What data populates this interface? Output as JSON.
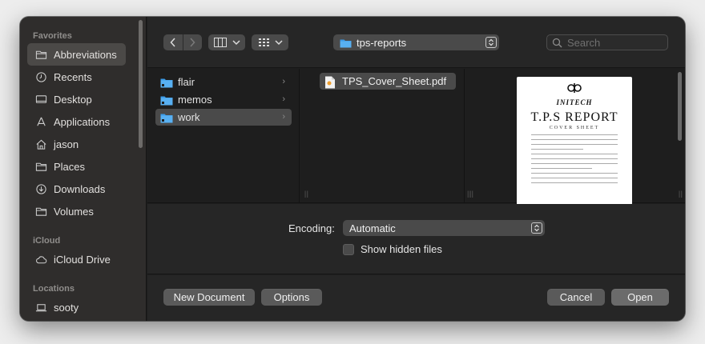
{
  "sidebar": {
    "favorites_title": "Favorites",
    "favorites": [
      {
        "label": "Abbreviations",
        "icon": "folder-icon"
      },
      {
        "label": "Recents",
        "icon": "clock-icon"
      },
      {
        "label": "Desktop",
        "icon": "desktop-icon"
      },
      {
        "label": "Applications",
        "icon": "applications-icon"
      },
      {
        "label": "jason",
        "icon": "home-icon"
      },
      {
        "label": "Places",
        "icon": "folder-icon"
      },
      {
        "label": "Downloads",
        "icon": "download-icon"
      },
      {
        "label": "Volumes",
        "icon": "folder-icon"
      }
    ],
    "icloud_title": "iCloud",
    "icloud": [
      {
        "label": "iCloud Drive",
        "icon": "cloud-icon"
      }
    ],
    "locations_title": "Locations",
    "locations": [
      {
        "label": "sooty",
        "icon": "laptop-icon"
      }
    ]
  },
  "toolbar": {
    "path_label": "tps-reports",
    "search_placeholder": "Search"
  },
  "browser": {
    "column1": [
      {
        "label": "flair"
      },
      {
        "label": "memos"
      },
      {
        "label": "work"
      }
    ],
    "column2": [
      {
        "label": "TPS_Cover_Sheet.pdf"
      }
    ],
    "preview": {
      "company": "INITECH",
      "title": "T.P.S  REPORT",
      "subtitle": "COVER SHEET"
    }
  },
  "options": {
    "encoding_label": "Encoding:",
    "encoding_value": "Automatic",
    "hidden_files_label": "Show hidden files"
  },
  "buttons": {
    "new_document": "New Document",
    "options": "Options",
    "cancel": "Cancel",
    "open": "Open"
  }
}
